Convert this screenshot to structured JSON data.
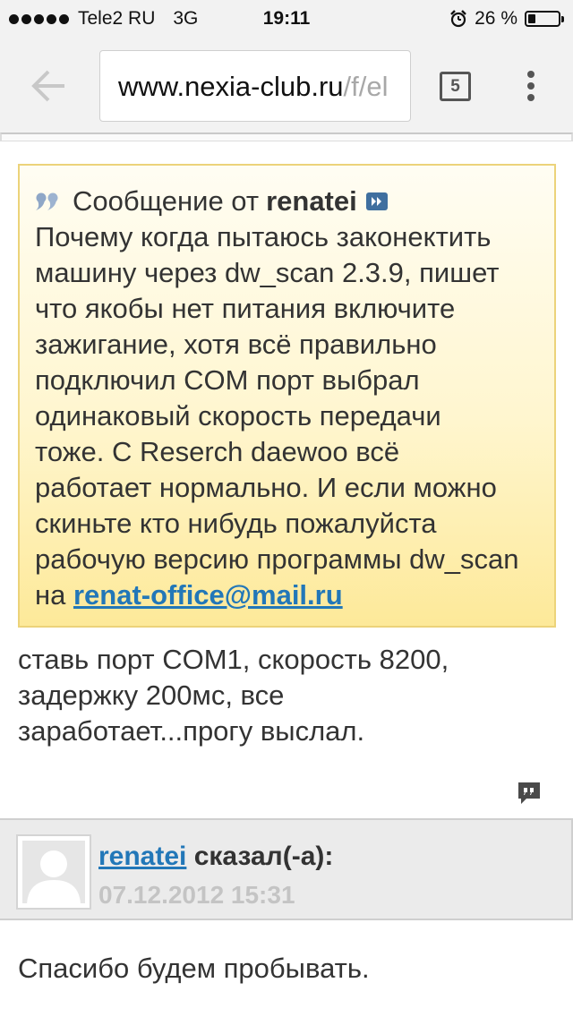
{
  "status_bar": {
    "carrier": "Tele2 RU",
    "network": "3G",
    "time": "19:11",
    "battery": "26 %",
    "battery_level": 0.26
  },
  "browser": {
    "url_visible": "www.nexia-club.ru",
    "url_faded": "/f/el",
    "tab_count": "5",
    "icons": [
      "back-arrow-icon",
      "tabs-icon",
      "overflow-menu-icon"
    ]
  },
  "quote": {
    "prefix": "Сообщение от",
    "author": "renatei",
    "body": "Почему когда пытаюсь законектить\nмашину через dw_scan 2.3.9, пишет\nчто якобы нет питания включите\nзажигание, хотя всё правильно\nподключил COM порт выбрал\nодинаковый скорость передачи\nтоже. С Reserch daewoo всё\nработает нормально. И если можно\nскиньте кто нибудь пожалуйста\nрабочую версию программы dw_scan",
    "body_tail_prefix": "на ",
    "email": "renat-office@mail.ru"
  },
  "reply": {
    "text": "ставь порт COM1, скорость 8200,\nзадержку 200мс, все\nзаработает...прогу выслал."
  },
  "post": {
    "author": "renatei",
    "said": "сказал(-а):",
    "date": "07.12.2012 15:31",
    "body": "Спасибо будем пробывать."
  },
  "colors": {
    "link": "#2277b8",
    "quote_bg": "#fff6cf",
    "quote_border": "#ecd37a",
    "date": "#c4c4c4"
  }
}
